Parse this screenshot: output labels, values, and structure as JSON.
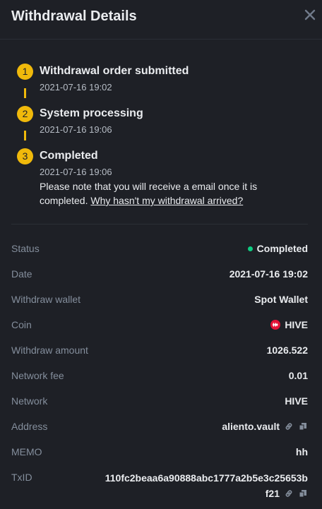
{
  "header": {
    "title": "Withdrawal Details",
    "close_icon": "close-icon"
  },
  "steps": [
    {
      "number": "1",
      "title": "Withdrawal order submitted",
      "time": "2021-07-16 19:02"
    },
    {
      "number": "2",
      "title": "System processing",
      "time": "2021-07-16 19:06"
    },
    {
      "number": "3",
      "title": "Completed",
      "time": "2021-07-16 19:06"
    }
  ],
  "note": {
    "text": "Please note that you will receive a email once it is completed.",
    "link": "Why hasn't my withdrawal arrived?"
  },
  "details": {
    "status": {
      "label": "Status",
      "value": "Completed",
      "color": "#0ecb81"
    },
    "date": {
      "label": "Date",
      "value": "2021-07-16 19:02"
    },
    "wallet": {
      "label": "Withdraw wallet",
      "value": "Spot Wallet"
    },
    "coin": {
      "label": "Coin",
      "value": "HIVE",
      "icon": "hive-icon"
    },
    "amount": {
      "label": "Withdraw amount",
      "value": "1026.522"
    },
    "fee": {
      "label": "Network fee",
      "value": "0.01"
    },
    "network": {
      "label": "Network",
      "value": "HIVE"
    },
    "address": {
      "label": "Address",
      "value": "aliento.vault"
    },
    "memo": {
      "label": "MEMO",
      "value": "hh"
    },
    "txid": {
      "label": "TxID",
      "value_line1": "110fc2beaa6a90888abc1777a2b5e3c25653b",
      "value_line2": "f21"
    }
  },
  "colors": {
    "accent": "#f0b90b",
    "background": "#1e2026",
    "label": "#848e9c",
    "success": "#0ecb81"
  }
}
